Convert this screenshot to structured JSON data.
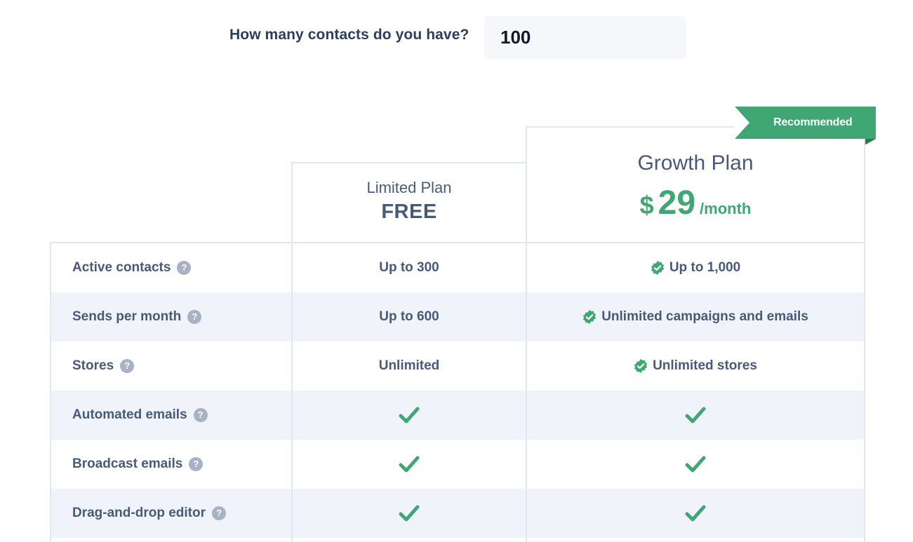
{
  "contacts": {
    "question": "How many contacts do you have?",
    "value": "100"
  },
  "plans": {
    "limited": {
      "name": "Limited Plan",
      "price": "FREE"
    },
    "growth": {
      "name": "Growth Plan",
      "currency": "$",
      "amount": "29",
      "period": "/month",
      "ribbon": "Recommended"
    }
  },
  "help_glyph": "?",
  "rows": [
    {
      "feature": "Active contacts",
      "limited": "Up to 300",
      "growth": "Up to 1,000"
    },
    {
      "feature": "Sends per month",
      "limited": "Up to 600",
      "growth": "Unlimited campaigns and emails"
    },
    {
      "feature": "Stores",
      "limited": "Unlimited",
      "growth": "Unlimited stores"
    },
    {
      "feature": "Automated emails",
      "limited_included": true,
      "growth_included": true
    },
    {
      "feature": "Broadcast emails",
      "limited_included": true,
      "growth_included": true
    },
    {
      "feature": "Drag-and-drop editor",
      "limited_included": true,
      "growth_included": true
    }
  ],
  "colors": {
    "accent": "#40a673",
    "text": "#485a78",
    "row_shade": "#f0f3fa",
    "border": "#e2e8f0",
    "help_icon": "#a9b2c4"
  }
}
